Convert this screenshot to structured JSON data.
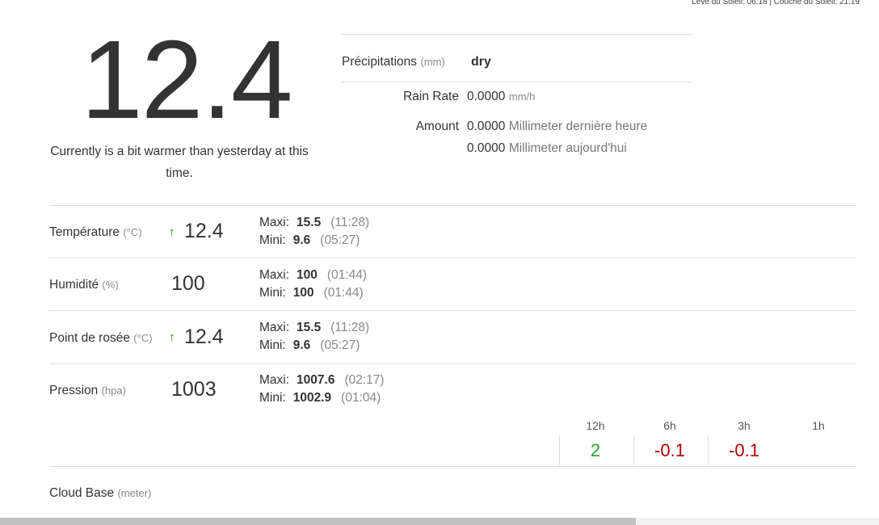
{
  "sun": {
    "text": "Levé du Soleil: 06:18 | Couché du Soleil: 21:19"
  },
  "current": {
    "temperature": "12.4",
    "comparison": "Currently is a bit warmer than yesterday at this time."
  },
  "precip": {
    "label": "Précipitations",
    "unit": "(mm)",
    "value": "dry",
    "rain_rate_label": "Rain Rate",
    "rain_rate_value": "0.0000",
    "rain_rate_unit": "mm/h",
    "amount_label": "Amount",
    "amount_hour_value": "0.0000",
    "amount_hour_unit": "Millimeter dernière heure",
    "amount_day_value": "0.0000",
    "amount_day_unit": "Millimeter aujourd'hui"
  },
  "rows": [
    {
      "label": "Température",
      "unit": "(°C)",
      "trend": "up",
      "arrow": "↑",
      "value": "12.4",
      "maxi_label": "Maxi:",
      "maxi": "15.5",
      "maxi_time": "(11:28)",
      "mini_label": "Mini:",
      "mini": "9.6",
      "mini_time": "(05:27)"
    },
    {
      "label": "Humidité",
      "unit": "(%)",
      "trend": "none",
      "arrow": "",
      "value": "100",
      "maxi_label": "Maxi:",
      "maxi": "100",
      "maxi_time": "(01:44)",
      "mini_label": "Mini:",
      "mini": "100",
      "mini_time": "(01:44)"
    },
    {
      "label": "Point de rosée",
      "unit": "(°C)",
      "trend": "up",
      "arrow": "↑",
      "value": "12.4",
      "maxi_label": "Maxi:",
      "maxi": "15.5",
      "maxi_time": "(11:28)",
      "mini_label": "Mini:",
      "mini": "9.6",
      "mini_time": "(05:27)"
    },
    {
      "label": "Pression",
      "unit": "(hpa)",
      "trend": "none",
      "arrow": "",
      "value": "1003",
      "maxi_label": "Maxi:",
      "maxi": "1007.6",
      "maxi_time": "(02:17)",
      "mini_label": "Mini:",
      "mini": "1002.9",
      "mini_time": "(01:04)"
    }
  ],
  "pressure_trend": {
    "headers": [
      "12h",
      "6h",
      "3h",
      "1h"
    ],
    "values": [
      "2",
      "-0.1",
      "-0.1",
      ""
    ],
    "colors": {
      "positive": "#2aa02a",
      "negative": "#b00000"
    }
  },
  "cloud_base": {
    "label": "Cloud Base",
    "unit": "(meter)"
  },
  "colors": {
    "trend_up_arrow": "#0a8a0a",
    "divider": "#dddddd",
    "text": "#333333"
  }
}
